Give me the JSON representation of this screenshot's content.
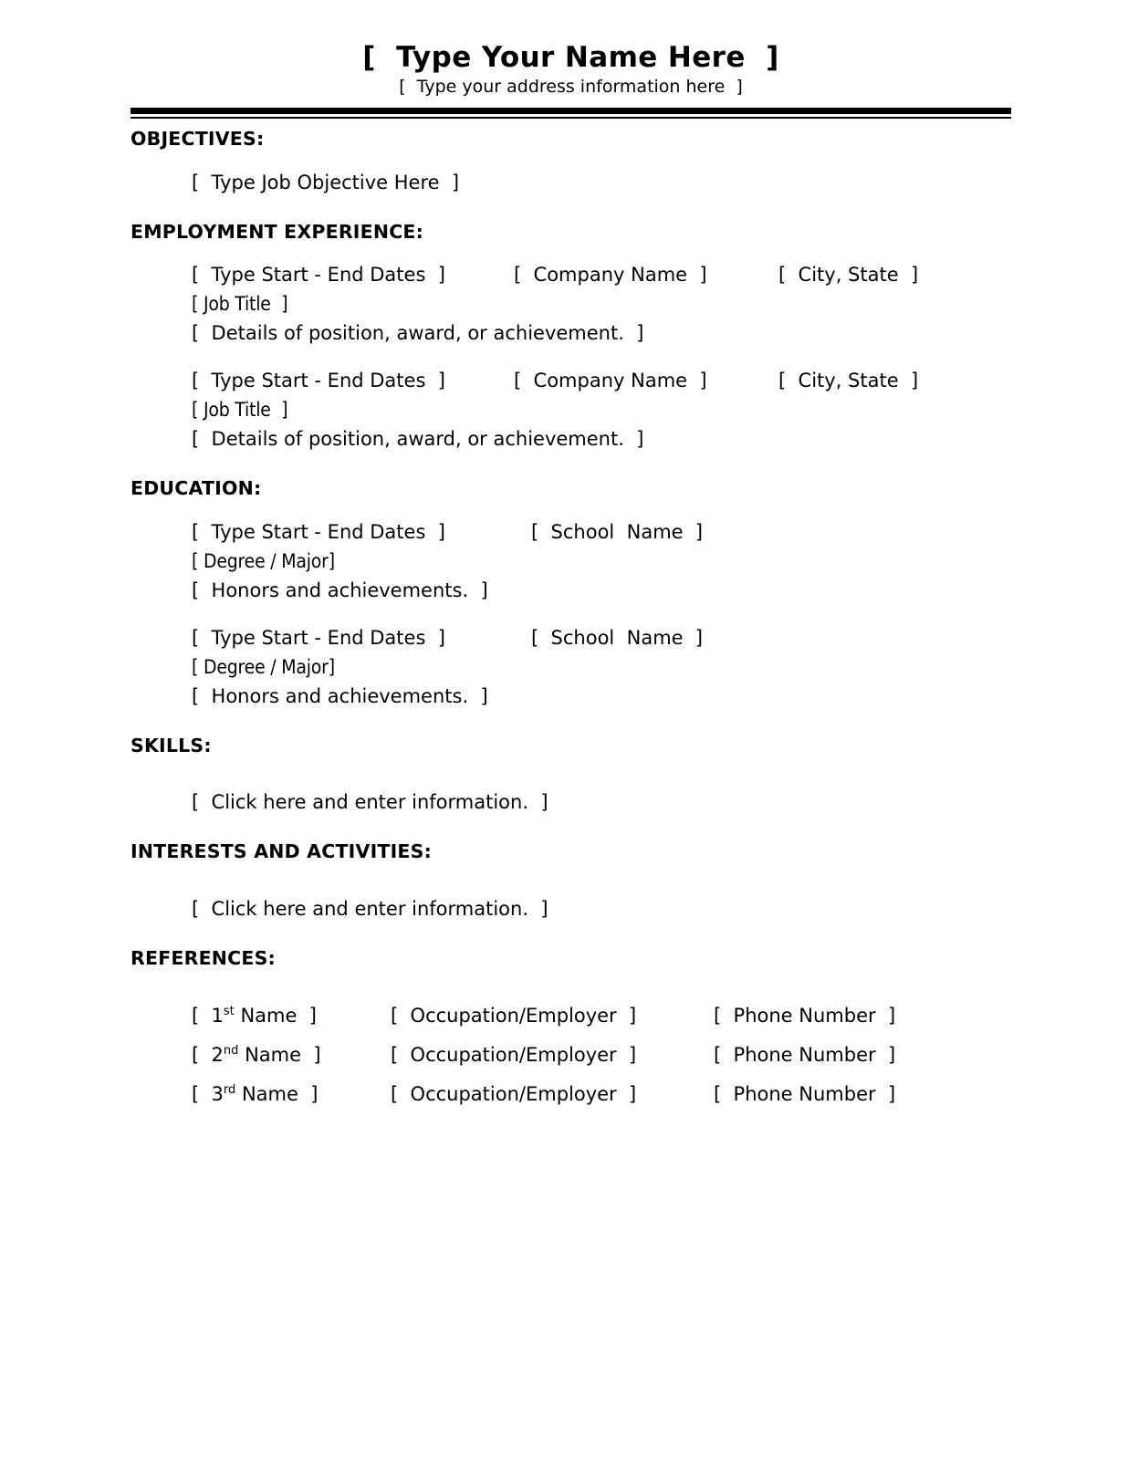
{
  "document": {
    "title": "[  Type Your Name Here  ]",
    "subtitle": "[  Type your address information here  ]"
  },
  "sections": {
    "objectives": {
      "heading": "OBJECTIVES:",
      "body": "[  Type Job Objective Here  ]"
    },
    "employment": {
      "heading": "EMPLOYMENT EXPERIENCE:",
      "entries": [
        {
          "dates": "[  Type Start - End Dates  ]",
          "company": "[  Company Name  ]",
          "city": "[  City, State  ]",
          "job_title": "[ Job Title  ]",
          "details": "[  Details of position, award, or achievement.  ]"
        },
        {
          "dates": "[  Type Start - End Dates  ]",
          "company": "[  Company Name  ]",
          "city": "[  City, State  ]",
          "job_title": "[ Job Title  ]",
          "details": "[  Details of position, award, or achievement.  ]"
        }
      ]
    },
    "education": {
      "heading": "EDUCATION:",
      "entries": [
        {
          "dates": "[  Type Start - End Dates  ]",
          "school": "[  School  Name  ]",
          "degree": "[ Degree / Major]",
          "honors": "[  Honors and achievements.  ]"
        },
        {
          "dates": "[  Type Start - End Dates  ]",
          "school": "[  School  Name  ]",
          "degree": "[ Degree / Major]",
          "honors": "[  Honors and achievements.  ]"
        }
      ]
    },
    "skills": {
      "heading": "SKILLS:",
      "body": "[  Click here and enter information.  ]"
    },
    "interests": {
      "heading": "INTERESTS AND ACTIVITIES:",
      "body": "[  Click here and enter information.  ]"
    },
    "references": {
      "heading": "REFERENCES:",
      "entries": [
        {
          "name_prefix": "[  1",
          "name_ordinal": "st",
          "name_suffix": " Name  ]",
          "occupation": "[  Occupation/Employer  ]",
          "phone": "[  Phone Number  ]"
        },
        {
          "name_prefix": "[  2",
          "name_ordinal": "nd",
          "name_suffix": " Name  ]",
          "occupation": "[  Occupation/Employer  ]",
          "phone": "[  Phone Number  ]"
        },
        {
          "name_prefix": "[  3",
          "name_ordinal": "rd",
          "name_suffix": " Name  ]",
          "occupation": "[  Occupation/Employer  ]",
          "phone": "[  Phone Number  ]"
        }
      ]
    }
  },
  "style": {
    "ink": "#000000",
    "paper": "#ffffff"
  }
}
